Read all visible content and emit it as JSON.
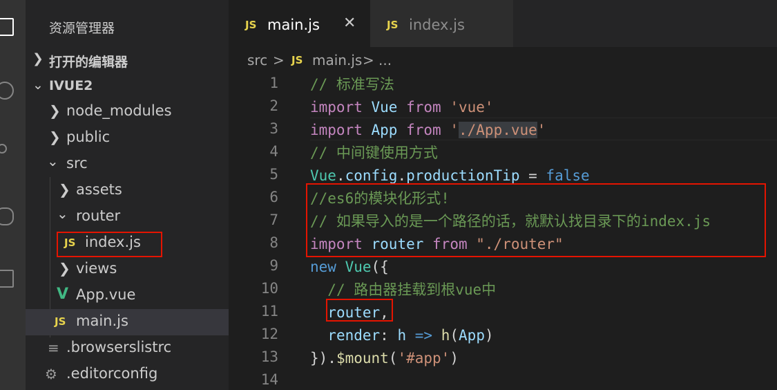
{
  "sidebar": {
    "title": "资源管理器",
    "open_editors_label": "打开的编辑器",
    "project_label": "IVUE2",
    "tree": [
      {
        "label": "node_modules",
        "type": "folder",
        "expanded": false
      },
      {
        "label": "public",
        "type": "folder",
        "expanded": false
      },
      {
        "label": "src",
        "type": "folder",
        "expanded": true
      },
      {
        "label": "assets",
        "type": "folder",
        "expanded": false
      },
      {
        "label": "router",
        "type": "folder",
        "expanded": true
      },
      {
        "label": "index.js",
        "type": "js",
        "badge": "JS"
      },
      {
        "label": "views",
        "type": "folder",
        "expanded": false
      },
      {
        "label": "App.vue",
        "type": "vue",
        "badge": "V"
      },
      {
        "label": "main.js",
        "type": "js",
        "badge": "JS",
        "selected": true
      },
      {
        "label": ".browserslistrc",
        "type": "file",
        "icon": "lines-icon"
      },
      {
        "label": ".editorconfig",
        "type": "file",
        "icon": "gear-icon"
      }
    ]
  },
  "tabs": [
    {
      "badge": "JS",
      "label": "main.js",
      "active": true,
      "close": "✕"
    },
    {
      "badge": "JS",
      "label": "index.js",
      "active": false
    }
  ],
  "breadcrumb": {
    "folder": "src",
    "sep": ">",
    "badge": "JS",
    "file": "main.js",
    "sep2": ">",
    "tail": "..."
  },
  "editor": {
    "line_numbers": [
      "1",
      "2",
      "3",
      "4",
      "5",
      "6",
      "7",
      "8",
      "9",
      "10",
      "11",
      "12",
      "13",
      "14"
    ],
    "lines": [
      [
        {
          "t": "// 标准写法",
          "c": "cmt"
        }
      ],
      [
        {
          "t": "import",
          "c": "kw"
        },
        {
          "t": " ",
          "c": "pl"
        },
        {
          "t": "Vue",
          "c": "var"
        },
        {
          "t": " ",
          "c": "pl"
        },
        {
          "t": "from",
          "c": "kw"
        },
        {
          "t": " ",
          "c": "pl"
        },
        {
          "t": "'vue'",
          "c": "str"
        }
      ],
      [
        {
          "t": "import",
          "c": "kw"
        },
        {
          "t": " ",
          "c": "pl"
        },
        {
          "t": "App",
          "c": "var"
        },
        {
          "t": " ",
          "c": "pl"
        },
        {
          "t": "from",
          "c": "kw"
        },
        {
          "t": " ",
          "c": "pl"
        },
        {
          "t": "'",
          "c": "str"
        },
        {
          "t": "./App.vue",
          "c": "str strbg"
        },
        {
          "t": "'",
          "c": "str"
        }
      ],
      [
        {
          "t": "// 中间键使用方式",
          "c": "cmt"
        }
      ],
      [
        {
          "t": "Vue",
          "c": "cls"
        },
        {
          "t": ".",
          "c": "pl"
        },
        {
          "t": "config",
          "c": "var"
        },
        {
          "t": ".",
          "c": "pl"
        },
        {
          "t": "productionTip",
          "c": "var"
        },
        {
          "t": " = ",
          "c": "pl"
        },
        {
          "t": "false",
          "c": "blue"
        }
      ],
      [
        {
          "t": "//es6的模块化形式!",
          "c": "cmt"
        }
      ],
      [
        {
          "t": "// 如果导入的是一个路径的话，就默认找目录下的index.js",
          "c": "cmt"
        }
      ],
      [
        {
          "t": "import",
          "c": "kw"
        },
        {
          "t": " ",
          "c": "pl"
        },
        {
          "t": "router",
          "c": "var"
        },
        {
          "t": " ",
          "c": "pl"
        },
        {
          "t": "from",
          "c": "kw"
        },
        {
          "t": " ",
          "c": "pl"
        },
        {
          "t": "\"./router\"",
          "c": "str"
        }
      ],
      [
        {
          "t": "new",
          "c": "blue"
        },
        {
          "t": " ",
          "c": "pl"
        },
        {
          "t": "Vue",
          "c": "cls"
        },
        {
          "t": "({",
          "c": "pl"
        }
      ],
      [
        {
          "t": "  ",
          "c": "pl"
        },
        {
          "t": "// 路由器挂载到根vue中",
          "c": "cmt"
        }
      ],
      [
        {
          "t": "  ",
          "c": "pl"
        },
        {
          "t": "router",
          "c": "var"
        },
        {
          "t": ",",
          "c": "pl"
        }
      ],
      [
        {
          "t": "  ",
          "c": "pl"
        },
        {
          "t": "render",
          "c": "var"
        },
        {
          "t": ": ",
          "c": "pl"
        },
        {
          "t": "h",
          "c": "var"
        },
        {
          "t": " ",
          "c": "pl"
        },
        {
          "t": "=>",
          "c": "blue"
        },
        {
          "t": " ",
          "c": "pl"
        },
        {
          "t": "h",
          "c": "fn"
        },
        {
          "t": "(",
          "c": "pl"
        },
        {
          "t": "App",
          "c": "var"
        },
        {
          "t": ")",
          "c": "pl"
        }
      ],
      [
        {
          "t": "}).",
          "c": "pl"
        },
        {
          "t": "$mount",
          "c": "fn"
        },
        {
          "t": "(",
          "c": "pl"
        },
        {
          "t": "'#app'",
          "c": "str"
        },
        {
          "t": ")",
          "c": "pl"
        }
      ],
      []
    ]
  },
  "colors": {
    "highlight_box": "#e51400",
    "js_badge": "#e8d44d",
    "vue_badge": "#41b883"
  }
}
